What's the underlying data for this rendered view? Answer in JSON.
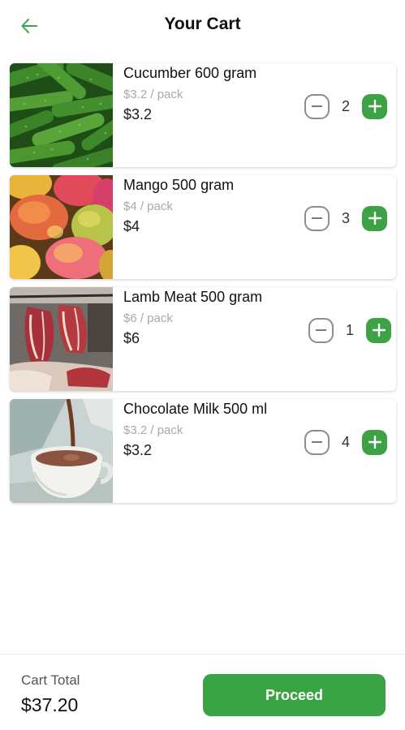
{
  "header": {
    "title": "Your Cart"
  },
  "cart": {
    "items": [
      {
        "name": "Cucumber 600 gram",
        "unit_price": "$3.2 / pack",
        "price": "$3.2",
        "quantity": "2"
      },
      {
        "name": "Mango 500 gram",
        "unit_price": "$4 / pack",
        "price": "$4",
        "quantity": "3"
      },
      {
        "name": "Lamb Meat 500 gram",
        "unit_price": "$6 / pack",
        "price": "$6",
        "quantity": "1"
      },
      {
        "name": "Chocolate Milk 500 ml",
        "unit_price": "$3.2 / pack",
        "price": "$3.2",
        "quantity": "4"
      }
    ]
  },
  "footer": {
    "total_label": "Cart Total",
    "total_value": "$37.20",
    "proceed_label": "Proceed"
  },
  "colors": {
    "accent": "#3ca245",
    "muted": "#a9a9a9",
    "text": "#1b1b1b"
  },
  "icons": {
    "back": "arrow-left-icon",
    "minus": "minus-icon",
    "plus": "plus-icon"
  }
}
